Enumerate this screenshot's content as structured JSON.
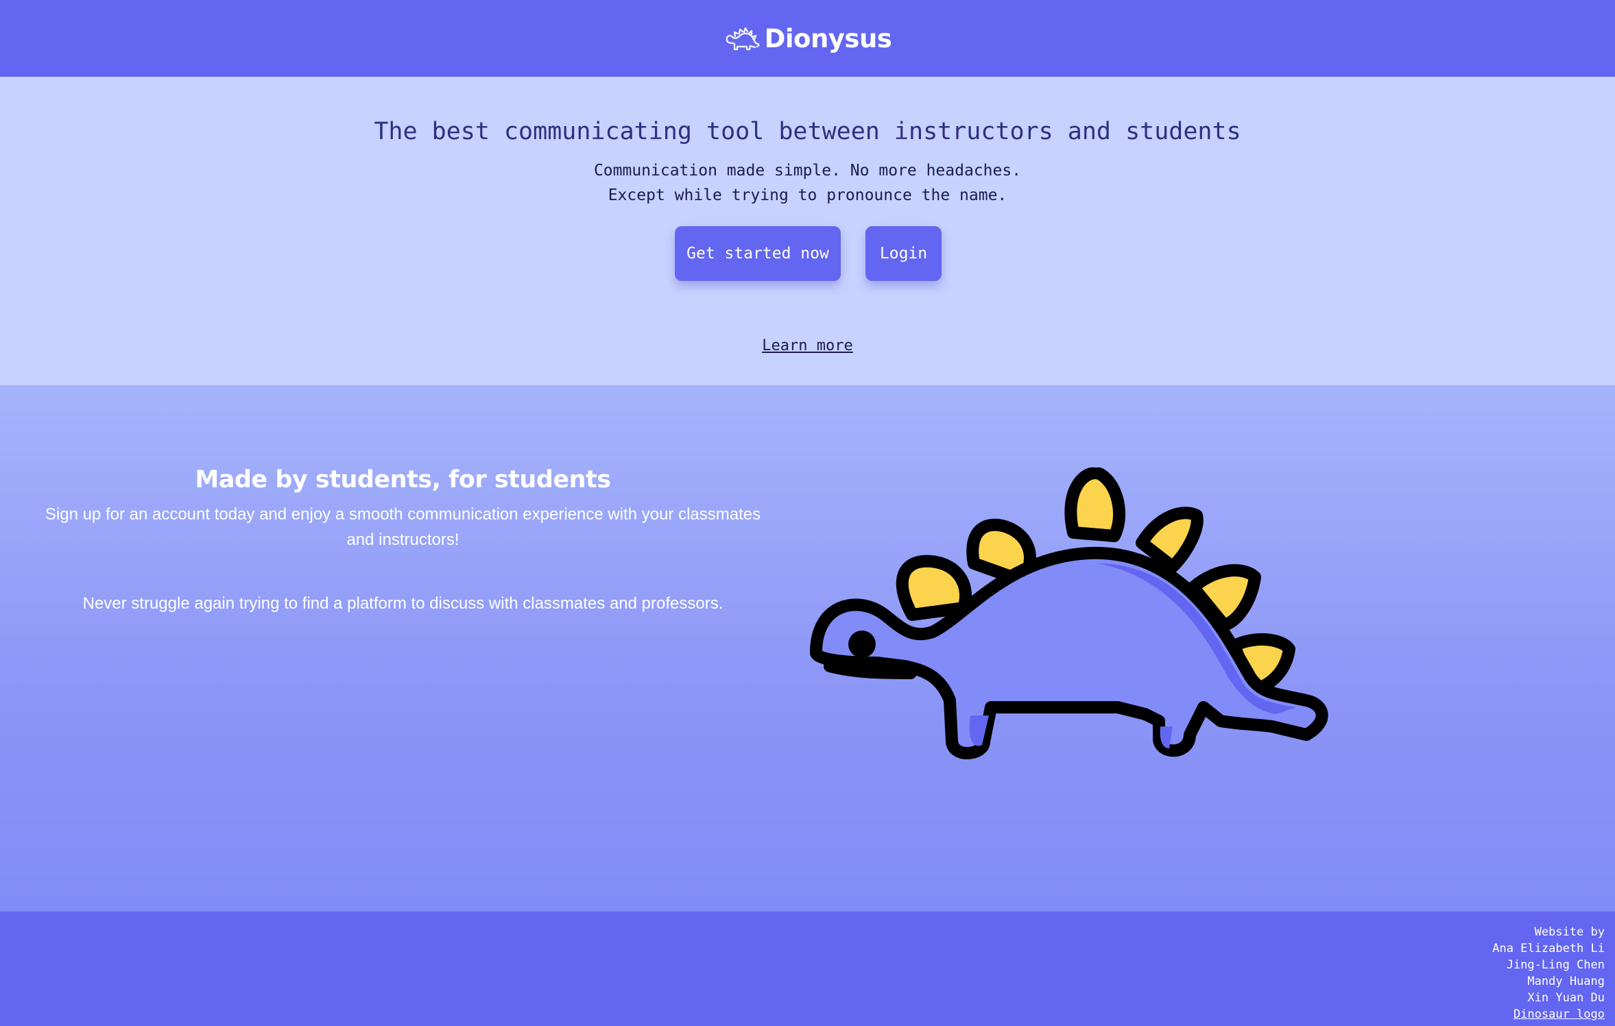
{
  "header": {
    "brand_name": "Dionysus",
    "logo_icon": "stegosaurus-outline-icon"
  },
  "hero": {
    "title": "The best communicating tool between instructors and students",
    "subtitle_line1": "Communication made simple. No more headaches.",
    "subtitle_line2": "Except while trying to pronounce the name.",
    "get_started_label": "Get started now",
    "login_label": "Login",
    "learn_more_label": "Learn more"
  },
  "feature": {
    "title": "Made by students, for students",
    "paragraph1": "Sign up for an account today and enjoy a smooth communication experience with your classmates and instructors!",
    "paragraph2": "Never struggle again trying to find a platform to discuss with classmates and professors.",
    "illustration_icon": "stegosaurus-illustration-icon"
  },
  "footer": {
    "website_by": "Website by",
    "authors": [
      "Ana Elizabeth Li",
      "Jing-Ling Chen",
      "Mandy Huang",
      "Xin Yuan Du"
    ],
    "logo_credit_link": "Dinosaur logo"
  },
  "colors": {
    "primary": "#6366f1",
    "hero_bg": "#c7d2fe",
    "feature_bg_top": "#a5b4fc",
    "feature_bg_bottom": "#818cf8",
    "dino_body": "#818cf8",
    "dino_plates": "#fcd34d",
    "text_dark": "#312e81"
  }
}
